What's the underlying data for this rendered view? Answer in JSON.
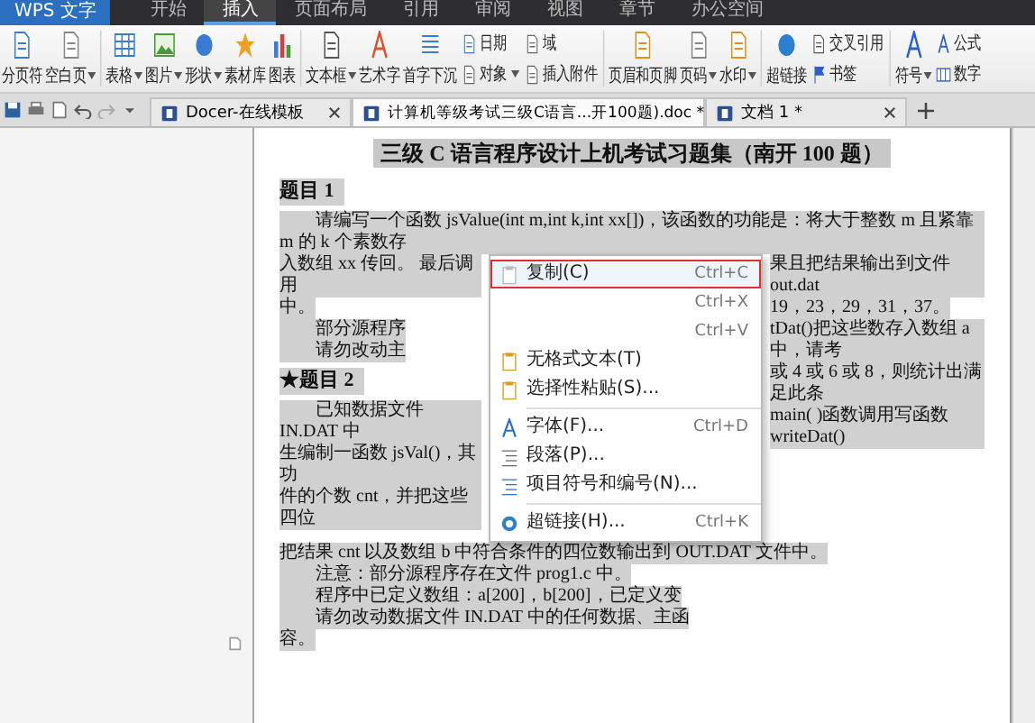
{
  "app_menu": {
    "label": "WPS 文字"
  },
  "ribbon_tabs": [
    {
      "label": "开始",
      "selected": false
    },
    {
      "label": "插入",
      "selected": true
    },
    {
      "label": "页面布局",
      "selected": false
    },
    {
      "label": "引用",
      "selected": false
    },
    {
      "label": "审阅",
      "selected": false
    },
    {
      "label": "视图",
      "selected": false
    },
    {
      "label": "章节",
      "selected": false
    },
    {
      "label": "办公空间",
      "selected": false
    }
  ],
  "ribbon_groups": [
    [
      {
        "kind": "large",
        "label": "分页符",
        "dropdown": false
      },
      {
        "kind": "large",
        "label": "空白页",
        "dropdown": true
      }
    ],
    [
      {
        "kind": "large",
        "label": "表格",
        "dropdown": true
      },
      {
        "kind": "large",
        "label": "图片",
        "dropdown": true
      },
      {
        "kind": "large",
        "label": "形状",
        "dropdown": true
      },
      {
        "kind": "large",
        "label": "素材库",
        "dropdown": false
      },
      {
        "kind": "large",
        "label": "图表",
        "dropdown": false
      }
    ],
    [
      {
        "kind": "large",
        "label": "文本框",
        "dropdown": true
      },
      {
        "kind": "large",
        "label": "艺术字",
        "dropdown": false
      },
      {
        "kind": "large",
        "label": "首字下沉",
        "dropdown": false
      },
      {
        "kind": "stack",
        "items": [
          {
            "label": "日期",
            "dropdown": false
          },
          {
            "label": "对象",
            "dropdown": true
          }
        ]
      },
      {
        "kind": "stack",
        "items": [
          {
            "label": "域",
            "dropdown": false
          },
          {
            "label": "插入附件",
            "dropdown": false
          }
        ]
      }
    ],
    [
      {
        "kind": "large",
        "label": "页眉和页脚",
        "dropdown": false
      },
      {
        "kind": "large",
        "label": "页码",
        "dropdown": true
      },
      {
        "kind": "large",
        "label": "水印",
        "dropdown": true
      }
    ],
    [
      {
        "kind": "large",
        "label": "超链接",
        "dropdown": false
      },
      {
        "kind": "stack",
        "items": [
          {
            "label": "交叉引用",
            "dropdown": false
          },
          {
            "label": "书签",
            "dropdown": false
          }
        ]
      }
    ],
    [
      {
        "kind": "large",
        "label": "符号",
        "dropdown": true
      },
      {
        "kind": "stack",
        "items": [
          {
            "label": "公式",
            "dropdown": false
          },
          {
            "label": "数字",
            "dropdown": false
          }
        ]
      }
    ]
  ],
  "doc_tabs": [
    {
      "label": "Docer-在线模板",
      "selected": false
    },
    {
      "label": "计算机等级考试三级C语言...开100题).doc *",
      "selected": true
    },
    {
      "label": "文档 1 *",
      "selected": false
    }
  ],
  "document": {
    "title": "三级 C 语言程序设计上机考试习题集（南开 100 题）",
    "top": [
      {
        "kind": "heading",
        "text": "题目 1"
      },
      {
        "kind": "para",
        "text": "请编写一个函数 jsValue(int m,int k,int xx[])，该函数的功能是：将大于整数 m 且紧靠 m 的 k 个素数存"
      }
    ],
    "left": [
      {
        "kind": "line",
        "text": "入数组 xx 传回。 最后调用"
      },
      {
        "kind": "line",
        "text": "中。"
      },
      {
        "kind": "para",
        "text": "部分源程序"
      },
      {
        "kind": "para",
        "text": "请勿改动主"
      },
      {
        "kind": "heading",
        "text": "★题目 2"
      },
      {
        "kind": "para",
        "text": "已知数据文件 IN.DAT 中"
      },
      {
        "kind": "line",
        "text": "生编制一函数 jsVal()，其功"
      },
      {
        "kind": "line",
        "text": "件的个数 cnt，并把这些四位"
      }
    ],
    "right": [
      {
        "text": "果且把结果输出到文件 out.dat"
      },
      {
        "text": "19，23，29，31，37。"
      },
      {
        "text": "tDat()把这些数存入数组 a 中，请考"
      },
      {
        "text": "或 4 或 6 或 8，则统计出满足此条"
      },
      {
        "text": "main( )函数调用写函数 writeDat()"
      }
    ],
    "bottom": [
      {
        "kind": "line",
        "text": "把结果 cnt 以及数组 b 中符合条件的四位数输出到 OUT.DAT 文件中。"
      },
      {
        "kind": "para",
        "text": "注意：部分源程序存在文件 prog1.c 中。"
      },
      {
        "kind": "para",
        "text": "程序中已定义数组：a[200]，b[200]，已定义变"
      },
      {
        "kind": "para",
        "text": "请勿改动数据文件 IN.DAT 中的任何数据、主函"
      },
      {
        "kind": "line",
        "text": "容。"
      }
    ]
  },
  "context_menu": [
    {
      "kind": "item",
      "label": "复制(C)",
      "shortcut": "Ctrl+C",
      "highlighted": true
    },
    {
      "kind": "item",
      "shortcut": "Ctrl+X",
      "highlighted": false
    },
    {
      "kind": "item",
      "shortcut": "Ctrl+V",
      "highlighted": false
    },
    {
      "kind": "item",
      "label": "无格式文本(T)",
      "highlighted": false
    },
    {
      "kind": "item",
      "label": "选择性粘贴(S)...",
      "highlighted": false
    },
    {
      "kind": "separator"
    },
    {
      "kind": "item",
      "label": "字体(F)...",
      "shortcut": "Ctrl+D",
      "highlighted": false
    },
    {
      "kind": "item",
      "label": "段落(P)...",
      "highlighted": false
    },
    {
      "kind": "item",
      "label": "项目符号和编号(N)...",
      "highlighted": false
    },
    {
      "kind": "separator"
    },
    {
      "kind": "item",
      "label": "超链接(H)...",
      "shortcut": "Ctrl+K",
      "highlighted": false
    }
  ]
}
